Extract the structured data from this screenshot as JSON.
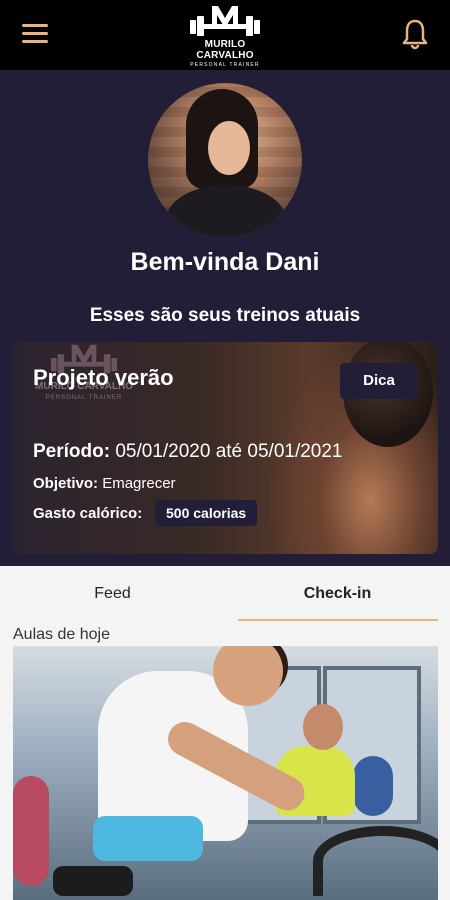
{
  "header": {
    "menu_icon": "hamburger-menu-icon",
    "logo": {
      "brand": "MURILO CARVALHO",
      "sub": "PERSONAL TRAINER"
    },
    "bell_icon": "bell-icon"
  },
  "profile": {
    "greeting": "Bem-vinda Dani",
    "subtitle": "Esses são seus treinos atuais"
  },
  "plan": {
    "title": "Projeto verão",
    "tip_label": "Dica",
    "period_label": "Período:",
    "period_value": "05/01/2020 até 05/01/2021",
    "goal_label": "Objetivo:",
    "goal_value": "Emagrecer",
    "calories_label": "Gasto calórico:",
    "calories_value": "500 calorias",
    "watermark_brand": "MURILO CARVALHO",
    "watermark_sub": "PERSONAL TRAINER"
  },
  "tabs": [
    {
      "label": "Feed",
      "active": false
    },
    {
      "label": "Check-in",
      "active": true
    }
  ],
  "classes": {
    "section_label": "Aulas de hoje"
  },
  "colors": {
    "accent": "#e8b47d",
    "hero_bg": "#221e38",
    "topbar_bg": "#000000"
  }
}
